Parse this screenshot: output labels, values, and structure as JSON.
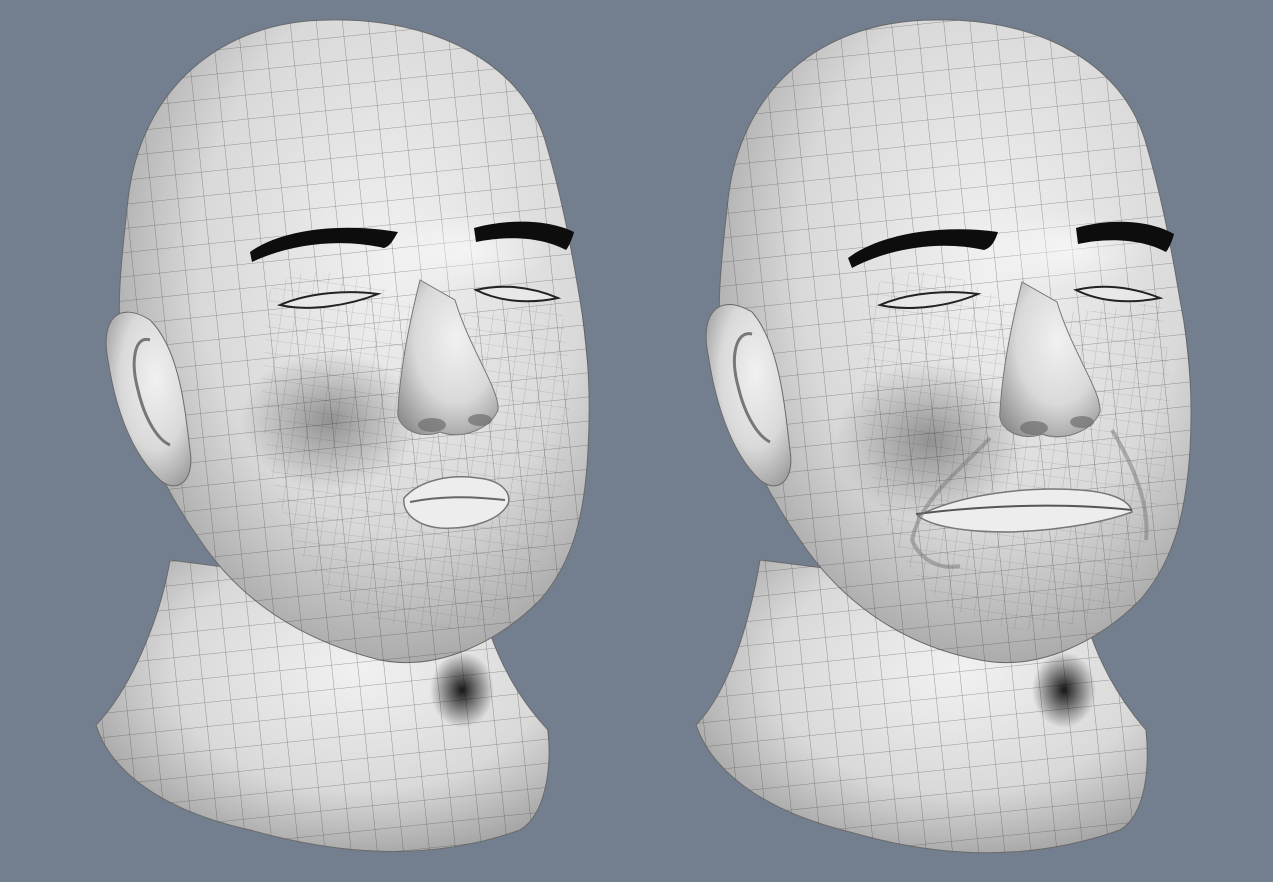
{
  "scene": {
    "background_color": "#737f8e",
    "skin_color": "#d9d9d9",
    "skin_highlight": "#f1f1f1",
    "skin_shadow": "#8f8f8f",
    "wire_color": "#3a3a3a",
    "brow_color": "#0d0d0d",
    "models": [
      {
        "expression": "pucker"
      },
      {
        "expression": "frown"
      }
    ]
  }
}
